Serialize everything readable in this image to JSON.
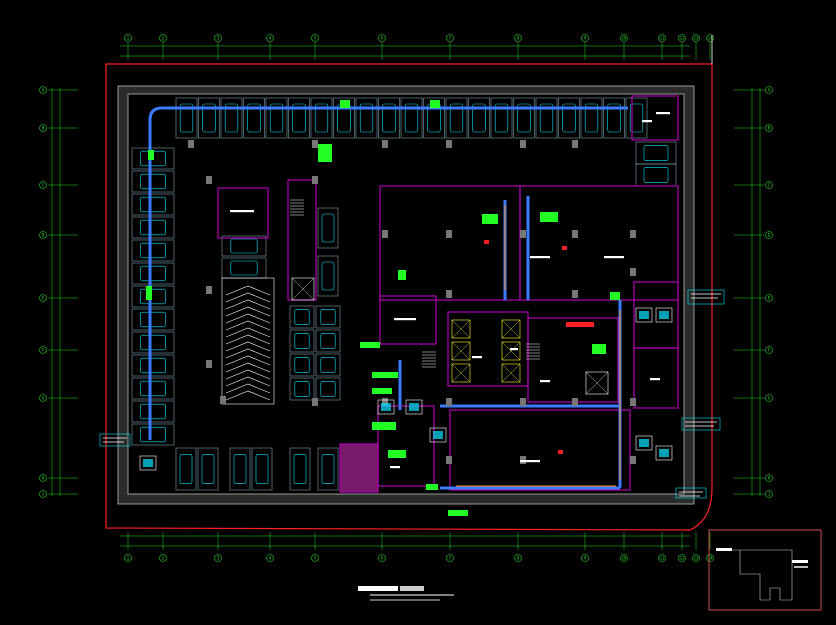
{
  "drawing": {
    "title": "",
    "colors": {
      "background": "#000000",
      "axis": "#22dd22",
      "wall": "#b8b8b8",
      "partition": "#b000b0",
      "duct": "#3a7bff",
      "equipment": "#00e5ff",
      "tag": "#22ff22",
      "boundary": "#ff2020",
      "accent_orange": "#ff8c1a",
      "accent_yellow": "#ffff33"
    }
  },
  "axes": {
    "top": [
      "1",
      "2",
      "3",
      "4",
      "5",
      "6",
      "7",
      "8",
      "9",
      "10",
      "11",
      "12",
      "13",
      "14"
    ],
    "left": [
      "A",
      "B",
      "C",
      "D",
      "E",
      "F",
      "G",
      "H",
      "J"
    ],
    "right": [
      "A",
      "B",
      "C",
      "D",
      "E",
      "F",
      "G",
      "H",
      "J"
    ]
  }
}
